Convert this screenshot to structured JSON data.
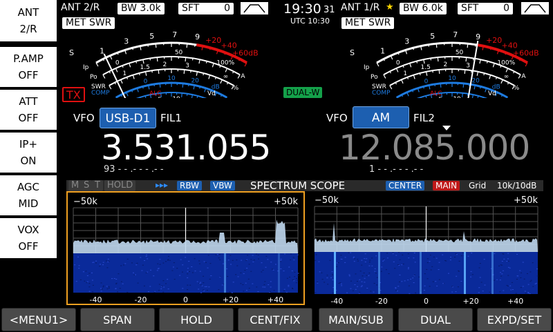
{
  "left_buttons": [
    {
      "l1": "ANT",
      "l2": "2/R"
    },
    {
      "l1": "P.AMP",
      "l2": "OFF"
    },
    {
      "l1": "ATT",
      "l2": "OFF"
    },
    {
      "l1": "IP+",
      "l2": "ON"
    },
    {
      "l1": "AGC",
      "l2": "MID"
    },
    {
      "l1": "VOX",
      "l2": "OFF"
    }
  ],
  "top_left": {
    "ant": "ANT 2/R",
    "bw_label": "BW",
    "bw_value": "3.0k",
    "sft_label": "SFT",
    "sft_value": "0",
    "met": "MET",
    "swr": "SWR"
  },
  "top_right": {
    "ant": "ANT 1/R",
    "bw_label": "BW",
    "bw_value": "6.0k",
    "sft_label": "SFT",
    "sft_value": "0",
    "met": "MET",
    "swr": "SWR"
  },
  "clock": {
    "time": "19:30",
    "seconds": "31",
    "utc": "UTC 10:30"
  },
  "status": {
    "tx": "TX",
    "dual": "DUAL-W"
  },
  "vfo_left": {
    "label": "VFO",
    "mode": "USB-D1",
    "filter": "FIL1",
    "freq": "3.531.055",
    "sub": "93 - - .- - - .- -"
  },
  "vfo_right": {
    "label": "VFO",
    "mode": "AM",
    "filter": "FIL2",
    "freq": "12.085.000",
    "sub": "1 - - .- - - .- -"
  },
  "meter_scale": {
    "s": [
      "1",
      "3",
      "5",
      "7",
      "9"
    ],
    "plus": [
      "+20",
      "+40",
      "+60dB"
    ],
    "po": [
      "0",
      "50",
      "100%"
    ],
    "swr": [
      "1",
      "1.5",
      "2",
      "3",
      "∞"
    ],
    "comp": [
      "0",
      "10",
      "20",
      "dB"
    ],
    "id": [
      "0",
      "5",
      "10",
      "15",
      "16V"
    ],
    "a": [
      "A",
      "%"
    ],
    "labels": {
      "s": "S",
      "ip": "Ip",
      "po": "Po",
      "swr": "SWR",
      "comp": "COMP",
      "alc": "ALC",
      "vd": "Vd"
    }
  },
  "scope": {
    "title": "SPECTRUM SCOPE",
    "flags": [
      "M",
      "S",
      "T",
      "HOLD"
    ],
    "arrows": "▸▸▸",
    "rbw": "RBW",
    "vbw": "VBW",
    "center": "CENTER",
    "main": "MAIN",
    "grid_label": "Grid",
    "grid_value": "10k/10dB",
    "left_span": "−50k",
    "right_span": "+50k",
    "axis": [
      "-40",
      "-20",
      "0",
      "+20",
      "+40"
    ]
  },
  "bottom_buttons": [
    "<MENU1>",
    "SPAN",
    "HOLD",
    "CENT/FIX",
    "MAIN/SUB",
    "DUAL",
    "EXPD/SET"
  ],
  "colors": {
    "accent_blue": "#1d5fb0",
    "tx_red": "#e01010",
    "dual_green": "#14a14a",
    "scope_orange": "#f0a020"
  }
}
